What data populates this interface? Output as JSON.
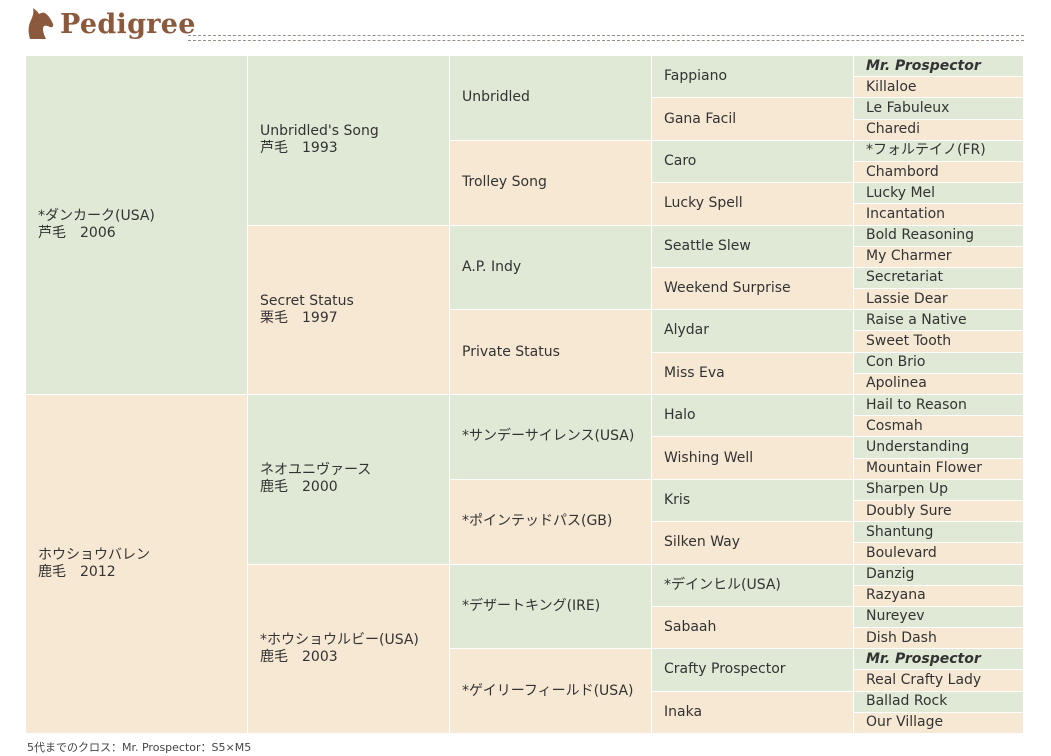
{
  "header": {
    "title": "Pedigree",
    "icon": "horse-head-icon"
  },
  "pedigree": {
    "g1": [
      {
        "name": "*ダンカーク(USA)",
        "info": "芦毛　2006"
      },
      {
        "name": "ホウショウバレン",
        "info": "鹿毛　2012"
      }
    ],
    "g2": [
      {
        "name": "Unbridled's Song",
        "info": "芦毛　1993"
      },
      {
        "name": "Secret Status",
        "info": "栗毛　1997"
      },
      {
        "name": "ネオユニヴァース",
        "info": "鹿毛　2000"
      },
      {
        "name": "*ホウショウルビー(USA)",
        "info": "鹿毛　2003"
      }
    ],
    "g3": [
      "Unbridled",
      "Trolley Song",
      "A.P. Indy",
      "Private Status",
      "*サンデーサイレンス(USA)",
      "*ポインテッドパス(GB)",
      "*デザートキング(IRE)",
      "*ゲイリーフィールド(USA)"
    ],
    "g4": [
      "Fappiano",
      "Gana Facil",
      "Caro",
      "Lucky Spell",
      "Seattle Slew",
      "Weekend Surprise",
      "Alydar",
      "Miss Eva",
      "Halo",
      "Wishing Well",
      "Kris",
      "Silken Way",
      "*デインヒル(USA)",
      "Sabaah",
      "Crafty Prospector",
      "Inaka"
    ],
    "g5": [
      "Mr. Prospector",
      "Killaloe",
      "Le Fabuleux",
      "Charedi",
      "*フォルテイノ(FR)",
      "Chambord",
      "Lucky Mel",
      "Incantation",
      "Bold Reasoning",
      "My Charmer",
      "Secretariat",
      "Lassie Dear",
      "Raise a Native",
      "Sweet Tooth",
      "Con Brio",
      "Apolinea",
      "Hail to Reason",
      "Cosmah",
      "Understanding",
      "Mountain Flower",
      "Sharpen Up",
      "Doubly Sure",
      "Shantung",
      "Boulevard",
      "Danzig",
      "Razyana",
      "Nureyev",
      "Dish Dash",
      "Mr. Prospector",
      "Real Crafty Lady",
      "Ballad Rock",
      "Our Village"
    ],
    "cross_indices": [
      0,
      28
    ]
  },
  "footnote": "5代までのクロス：Mr. Prospector：S5×M5",
  "colors": {
    "green": "#dfe9d6",
    "beige": "#f7e8d4",
    "title": "#8b5a3c"
  }
}
